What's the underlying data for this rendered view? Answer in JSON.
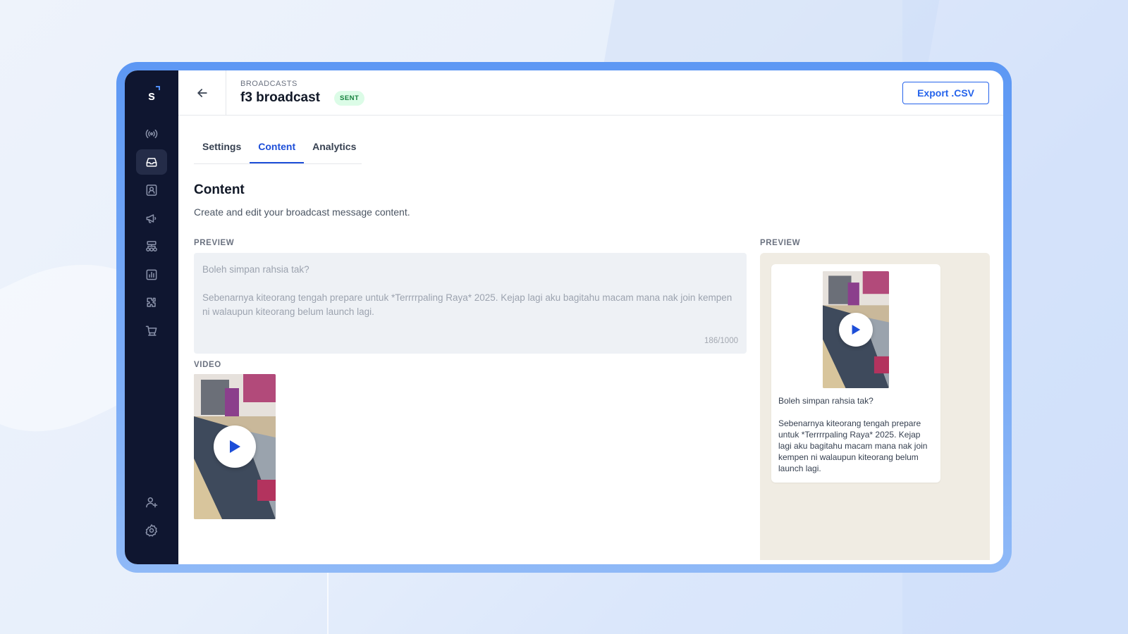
{
  "app": {
    "logo_letter": "s"
  },
  "sidebar": {
    "items": [
      {
        "icon": "broadcast-signal-icon",
        "active": false
      },
      {
        "icon": "inbox-icon",
        "active": true
      },
      {
        "icon": "contact-book-icon",
        "active": false
      },
      {
        "icon": "megaphone-icon",
        "active": false
      },
      {
        "icon": "flow-hierarchy-icon",
        "active": false
      },
      {
        "icon": "bar-chart-icon",
        "active": false
      },
      {
        "icon": "puzzle-icon",
        "active": false
      },
      {
        "icon": "shopping-cart-icon",
        "active": false
      }
    ],
    "bottom": [
      {
        "icon": "add-user-icon"
      },
      {
        "icon": "gear-icon"
      }
    ]
  },
  "header": {
    "breadcrumb": "BROADCASTS",
    "title": "f3 broadcast",
    "status": "SENT",
    "export_label": "Export .CSV"
  },
  "tabs": [
    {
      "label": "Settings",
      "active": false
    },
    {
      "label": "Content",
      "active": true
    },
    {
      "label": "Analytics",
      "active": false
    }
  ],
  "section": {
    "title": "Content",
    "subtitle": "Create and edit your broadcast message content."
  },
  "editor": {
    "label": "PREVIEW",
    "text": "Boleh simpan rahsia tak?\n\nSebenarnya kiteorang tengah prepare untuk *Terrrrpaling Raya* 2025. Kejap lagi aku bagitahu macam mana nak join kempen ni walaupun kiteorang belum launch lagi.",
    "char_count": "186/1000",
    "video_label": "VIDEO"
  },
  "phone_preview": {
    "label": "PREVIEW",
    "message": "Boleh simpan rahsia tak?\n\nSebenarnya kiteorang tengah prepare untuk *Terrrrpaling Raya* 2025. Kejap lagi aku bagitahu macam mana nak join kempen ni walaupun kiteorang belum launch lagi."
  },
  "colors": {
    "accent": "#1d4ed8",
    "sidebar_bg": "#0f1630",
    "status_green": "#15803d",
    "phone_bg": "#f0ece3"
  }
}
